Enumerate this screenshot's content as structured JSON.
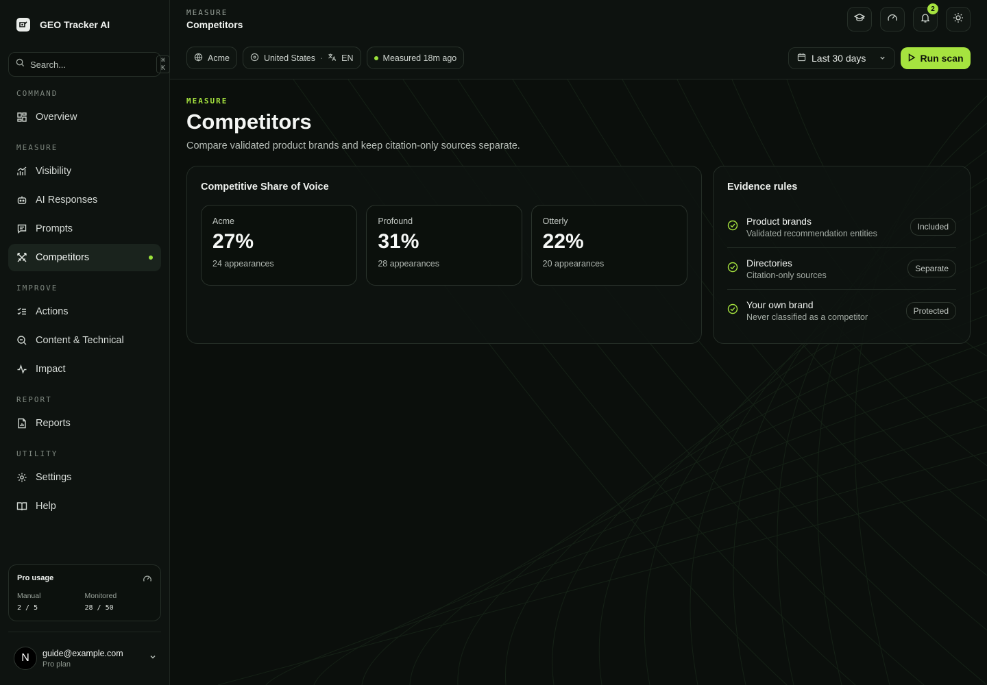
{
  "app": {
    "name": "GEO Tracker AI"
  },
  "search": {
    "placeholder": "Search...",
    "shortcut": "⌘ K"
  },
  "sidebar": {
    "sections": [
      {
        "label": "COMMAND",
        "items": [
          {
            "label": "Overview",
            "icon": "grid-icon"
          }
        ]
      },
      {
        "label": "MEASURE",
        "items": [
          {
            "label": "Visibility",
            "icon": "chart-icon"
          },
          {
            "label": "AI Responses",
            "icon": "bot-icon"
          },
          {
            "label": "Prompts",
            "icon": "message-icon"
          },
          {
            "label": "Competitors",
            "icon": "swords-icon",
            "active": true
          }
        ]
      },
      {
        "label": "IMPROVE",
        "items": [
          {
            "label": "Actions",
            "icon": "checklist-icon"
          },
          {
            "label": "Content & Technical",
            "icon": "search-doc-icon"
          },
          {
            "label": "Impact",
            "icon": "activity-icon"
          }
        ]
      },
      {
        "label": "REPORT",
        "items": [
          {
            "label": "Reports",
            "icon": "file-chart-icon"
          }
        ]
      },
      {
        "label": "UTILITY",
        "items": [
          {
            "label": "Settings",
            "icon": "gear-icon"
          },
          {
            "label": "Help",
            "icon": "book-icon"
          }
        ]
      }
    ]
  },
  "usage": {
    "title": "Pro usage",
    "manual_label": "Manual",
    "manual_value": "2 / 5",
    "monitored_label": "Monitored",
    "monitored_value": "28 / 50"
  },
  "user": {
    "initial": "N",
    "email": "guide@example.com",
    "plan": "Pro plan"
  },
  "header": {
    "crumb_label": "MEASURE",
    "crumb_title": "Competitors",
    "notification_count": "2",
    "chips": {
      "brand": "Acme",
      "country": "United States",
      "lang": "EN",
      "measured": "Measured 18m ago"
    },
    "date_range": "Last 30 days",
    "run_scan": "Run scan"
  },
  "page": {
    "eyebrow": "MEASURE",
    "title": "Competitors",
    "subtitle": "Compare validated product brands and keep citation-only sources separate."
  },
  "sov": {
    "title": "Competitive Share of Voice",
    "stats": [
      {
        "name": "Acme",
        "pct": "27%",
        "appearances": "24 appearances"
      },
      {
        "name": "Profound",
        "pct": "31%",
        "appearances": "28 appearances"
      },
      {
        "name": "Otterly",
        "pct": "22%",
        "appearances": "20 appearances"
      }
    ]
  },
  "rules": {
    "title": "Evidence rules",
    "items": [
      {
        "title": "Product brands",
        "desc": "Validated recommendation entities",
        "status": "Included"
      },
      {
        "title": "Directories",
        "desc": "Citation-only sources",
        "status": "Separate"
      },
      {
        "title": "Your own brand",
        "desc": "Never classified as a competitor",
        "status": "Protected"
      }
    ]
  },
  "colors": {
    "accent": "#a6e33f",
    "background": "#0b0f0c",
    "sidebar": "#0e1310"
  }
}
